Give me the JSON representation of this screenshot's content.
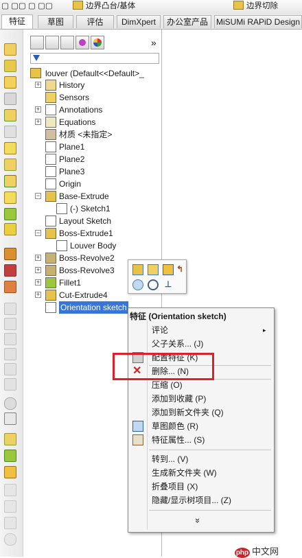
{
  "topbar": {
    "cmd1": "边界凸台/基体",
    "cmd2": "边界切除"
  },
  "tabs": [
    {
      "label": "特征"
    },
    {
      "label": "草图"
    },
    {
      "label": "评估"
    },
    {
      "label": "DimXpert"
    },
    {
      "label": "办公室产品"
    },
    {
      "label": "MiSUMi RAPiD Design"
    }
  ],
  "panel": {
    "more": "»",
    "filter_icon": "funnel-icon",
    "root": "louver  (Default<<Default>_",
    "items": [
      {
        "label": "History",
        "expand": "+"
      },
      {
        "label": "Sensors",
        "expand": ""
      },
      {
        "label": "Annotations",
        "expand": "+"
      },
      {
        "label": "Equations",
        "expand": "+"
      },
      {
        "label": "材质 <未指定>",
        "expand": ""
      },
      {
        "label": "Plane1",
        "expand": ""
      },
      {
        "label": "Plane2",
        "expand": ""
      },
      {
        "label": "Plane3",
        "expand": ""
      },
      {
        "label": "Origin",
        "expand": ""
      },
      {
        "label": "Base-Extrude",
        "expand": "−"
      },
      {
        "label": "(-) Sketch1",
        "expand": ""
      },
      {
        "label": "Layout Sketch",
        "expand": ""
      },
      {
        "label": "Boss-Extrude1",
        "expand": "−"
      },
      {
        "label": "Louver Body",
        "expand": ""
      },
      {
        "label": "Boss-Revolve2",
        "expand": "+"
      },
      {
        "label": "Boss-Revolve3",
        "expand": "+"
      },
      {
        "label": "Fillet1",
        "expand": "+"
      },
      {
        "label": "Cut-Extrude4",
        "expand": "+"
      },
      {
        "label": "Orientation sketch",
        "expand": ""
      }
    ]
  },
  "context_menu": {
    "title": "特征 (Orientation sketch)",
    "items": [
      {
        "label": "评论",
        "submenu": "▸"
      },
      {
        "label": "父子关系... (J)"
      },
      {
        "label": "配置特征 (K)"
      },
      {
        "label": "删除... (N)"
      },
      {
        "label": "压缩 (O)"
      },
      {
        "label": "添加到收藏 (P)"
      },
      {
        "label": "添加到新文件夹 (Q)"
      },
      {
        "label": "草图颜色 (R)"
      },
      {
        "label": "特征属性... (S)"
      },
      {
        "label": "转到... (V)"
      },
      {
        "label": "生成新文件夹 (W)"
      },
      {
        "label": "折叠项目 (X)"
      },
      {
        "label": "隐藏/显示树项目... (Z)"
      }
    ],
    "more": "»"
  },
  "watermark": {
    "logo": "php",
    "text": "中文网"
  },
  "colors": {
    "selection": "#3875d7",
    "highlight_box": "#d9222a"
  }
}
